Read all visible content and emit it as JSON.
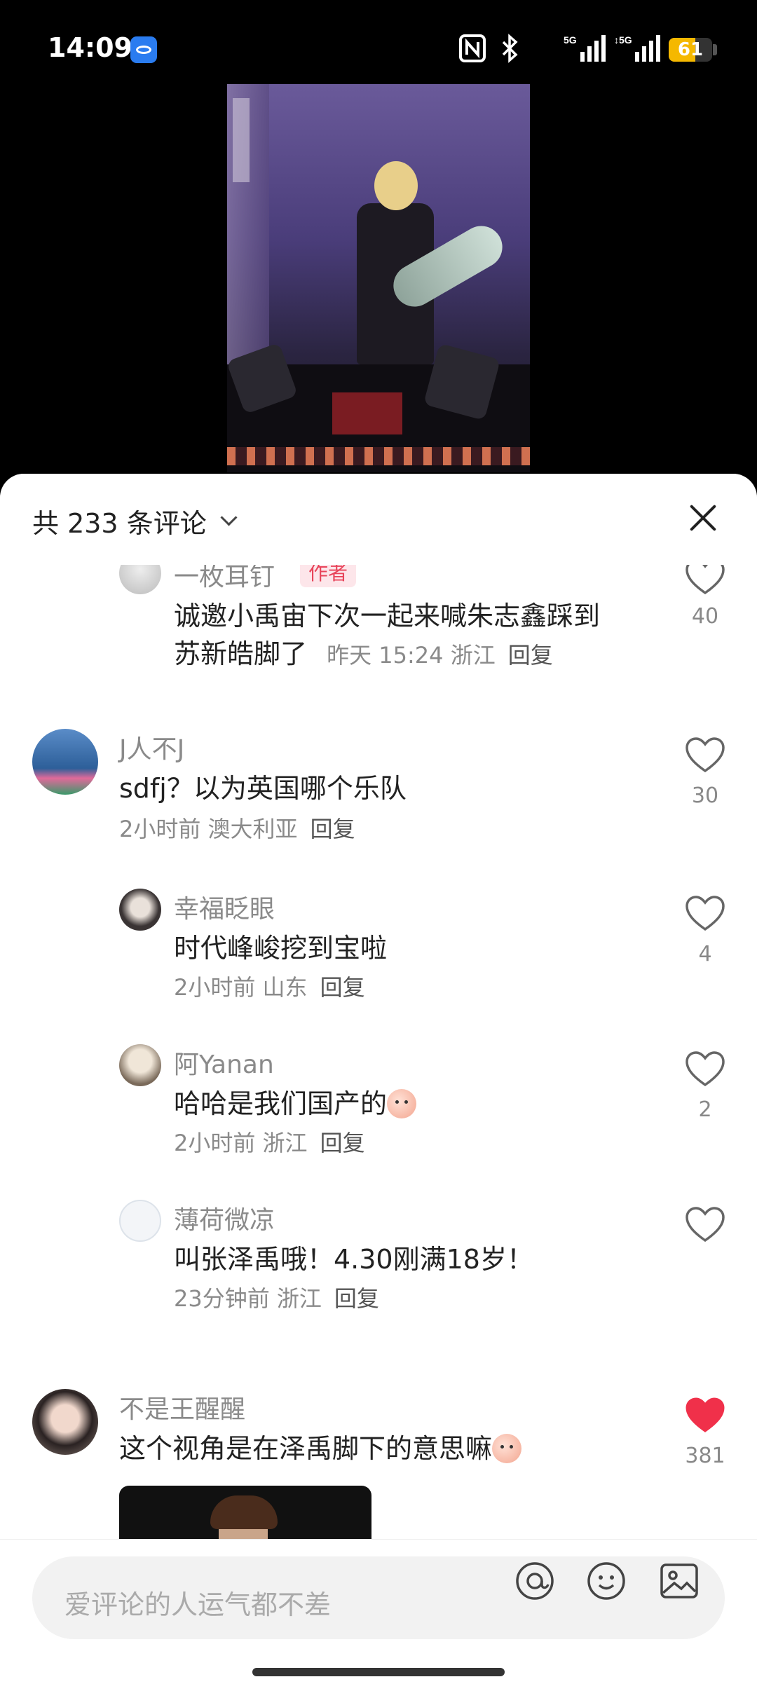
{
  "status_bar": {
    "time": "14:09",
    "battery": "61",
    "battery_level": 0.61,
    "icons": [
      "nfc-icon",
      "bluetooth-icon",
      "signal-5g-icon",
      "signal-5g-icon"
    ]
  },
  "comments_panel": {
    "count_label": "共 233 条评论",
    "comments": [
      {
        "username": "一枚耳钉",
        "author_tag": "作者",
        "text_line1": "诚邀小禹宙下次一起来喊朱志鑫踩到",
        "text_line2": "苏新皓脚了",
        "time": "昨天 15:24",
        "location": "浙江",
        "reply": "回复",
        "likes": "40",
        "liked": false,
        "reply_level": true
      },
      {
        "username": "J人不J",
        "text_line1": "sdfj？以为英国哪个乐队",
        "time": "2小时前",
        "location": "澳大利亚",
        "reply": "回复",
        "likes": "30",
        "liked": false,
        "reply_level": false
      },
      {
        "username": "幸福眨眼",
        "text_line1": "时代峰峻挖到宝啦",
        "time": "2小时前",
        "location": "山东",
        "reply": "回复",
        "likes": "4",
        "liked": false,
        "reply_level": true
      },
      {
        "username": "阿Yanan",
        "text_line1": "哈哈是我们国产的",
        "time": "2小时前",
        "location": "浙江",
        "reply": "回复",
        "likes": "2",
        "liked": false,
        "reply_level": true,
        "emoji": "peach-face-emoji"
      },
      {
        "username": "薄荷微凉",
        "text_line1": "叫张泽禹哦！4.30刚满18岁！",
        "time": "23分钟前",
        "location": "浙江",
        "reply": "回复",
        "likes": "",
        "liked": false,
        "reply_level": true
      },
      {
        "username": "不是王醒醒",
        "text_line1": "这个视角是在泽禹脚下的意思嘛",
        "likes": "381",
        "liked": true,
        "reply_level": false,
        "emoji": "peach-face-emoji"
      }
    ]
  },
  "input": {
    "placeholder": "爱评论的人运气都不差",
    "icons": [
      "at-icon",
      "emoji-icon",
      "image-icon"
    ]
  },
  "colors": {
    "like_active": "#f0304a",
    "author_tag": "#e8445a",
    "battery": "#f5b800"
  }
}
